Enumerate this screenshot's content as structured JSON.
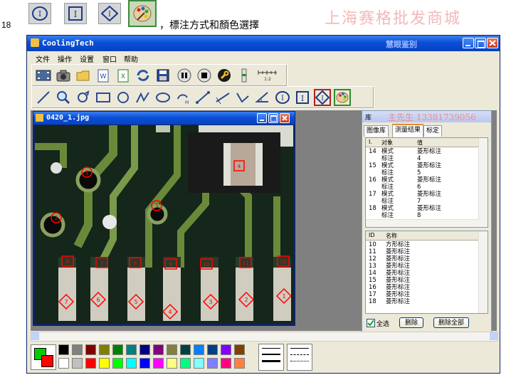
{
  "doc": {
    "line_number": "18",
    "caption": "，標注方式和顏色選擇",
    "watermark_top": "上海赛格批发商城",
    "watermark_sub": "慧眼鉴别",
    "watermark_phone": "主先生 13381739056"
  },
  "app": {
    "title": "CoolingTech",
    "menu": [
      "文件",
      "操作",
      "设置",
      "窗口",
      "帮助"
    ]
  },
  "image_window": {
    "title": "0420_1.jpg"
  },
  "library": {
    "title": "库",
    "tabs": [
      "图像库",
      "测量结果",
      "标定"
    ],
    "measure_headers": {
      "id": "I.",
      "object": "对象",
      "value": "值"
    },
    "measure_rows": [
      {
        "id": "14",
        "object": "模式",
        "value": "菱形标注"
      },
      {
        "id": "",
        "object": "标注",
        "value": "4"
      },
      {
        "id": "15",
        "object": "模式",
        "value": "菱形标注"
      },
      {
        "id": "",
        "object": "标注",
        "value": "5"
      },
      {
        "id": "16",
        "object": "模式",
        "value": "菱形标注"
      },
      {
        "id": "",
        "object": "标注",
        "value": "6"
      },
      {
        "id": "17",
        "object": "模式",
        "value": "菱形标注"
      },
      {
        "id": "",
        "object": "标注",
        "value": "7"
      },
      {
        "id": "18",
        "object": "模式",
        "value": "菱形标注"
      },
      {
        "id": "",
        "object": "标注",
        "value": "8"
      }
    ],
    "name_headers": {
      "id": "ID",
      "name": "名称"
    },
    "name_rows": [
      {
        "id": "10",
        "name": "方形标注"
      },
      {
        "id": "11",
        "name": "菱形标注"
      },
      {
        "id": "12",
        "name": "菱形标注"
      },
      {
        "id": "13",
        "name": "菱形标注"
      },
      {
        "id": "14",
        "name": "菱形标注"
      },
      {
        "id": "15",
        "name": "菱形标注"
      },
      {
        "id": "16",
        "name": "菱形标注"
      },
      {
        "id": "17",
        "name": "菱形标注"
      },
      {
        "id": "18",
        "name": "菱形标注"
      }
    ],
    "select_all": "全选",
    "delete": "删除",
    "delete_all": "删除全部"
  },
  "annotations": {
    "circles": [
      "1",
      "2",
      "3"
    ],
    "squares": [
      "4",
      "6",
      "7",
      "8",
      "9",
      "10",
      "11",
      "12"
    ],
    "diamonds": [
      "1",
      "2",
      "3",
      "4",
      "5",
      "6",
      "7",
      "8"
    ]
  },
  "palette": {
    "fg": "#00cc00",
    "bg": "#ff0000",
    "swatches": [
      "#000000",
      "#808080",
      "#800000",
      "#808000",
      "#008000",
      "#008080",
      "#000080",
      "#800080",
      "#808040",
      "#004040",
      "#0080ff",
      "#004080",
      "#8000ff",
      "#804000",
      "#ffffff",
      "#c0c0c0",
      "#ff0000",
      "#ffff00",
      "#00ff00",
      "#00ffff",
      "#0000ff",
      "#ff00ff",
      "#ffff80",
      "#00ff80",
      "#80ffff",
      "#8080ff",
      "#ff0080",
      "#ff8040"
    ]
  },
  "colors": {
    "title_blue": "#0a4fd6",
    "annotation_red": "#ff0000",
    "pcb_green": "#1f3a1f"
  }
}
